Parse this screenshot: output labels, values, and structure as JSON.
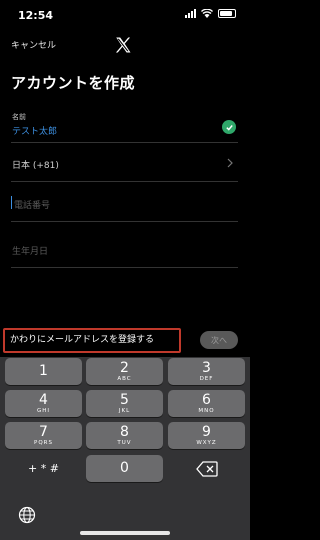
{
  "status_bar": {
    "time": "12:54"
  },
  "nav": {
    "cancel_label": "キャンセル",
    "logo_icon": "x-logo-icon"
  },
  "page": {
    "title": "アカウントを作成"
  },
  "form": {
    "name_label": "名前",
    "name_value": "テスト太郎",
    "country_code": "日本 (+81)",
    "phone_placeholder": "電話番号",
    "birthdate_placeholder": "生年月日"
  },
  "actions": {
    "use_email_label": "かわりにメールアドレスを登録する",
    "next_label": "次へ"
  },
  "keypad": {
    "keys": [
      {
        "digit": "1",
        "letters": ""
      },
      {
        "digit": "2",
        "letters": "ABC"
      },
      {
        "digit": "3",
        "letters": "DEF"
      },
      {
        "digit": "4",
        "letters": "GHI"
      },
      {
        "digit": "5",
        "letters": "JKL"
      },
      {
        "digit": "6",
        "letters": "MNO"
      },
      {
        "digit": "7",
        "letters": "PQRS"
      },
      {
        "digit": "8",
        "letters": "TUV"
      },
      {
        "digit": "9",
        "letters": "WXYZ"
      },
      {
        "digit": "0",
        "letters": ""
      }
    ],
    "symbols_label": "+ * #"
  },
  "colors": {
    "accent": "#3d8fe0",
    "check": "#2fa86a",
    "highlight_border": "#c0392b"
  }
}
